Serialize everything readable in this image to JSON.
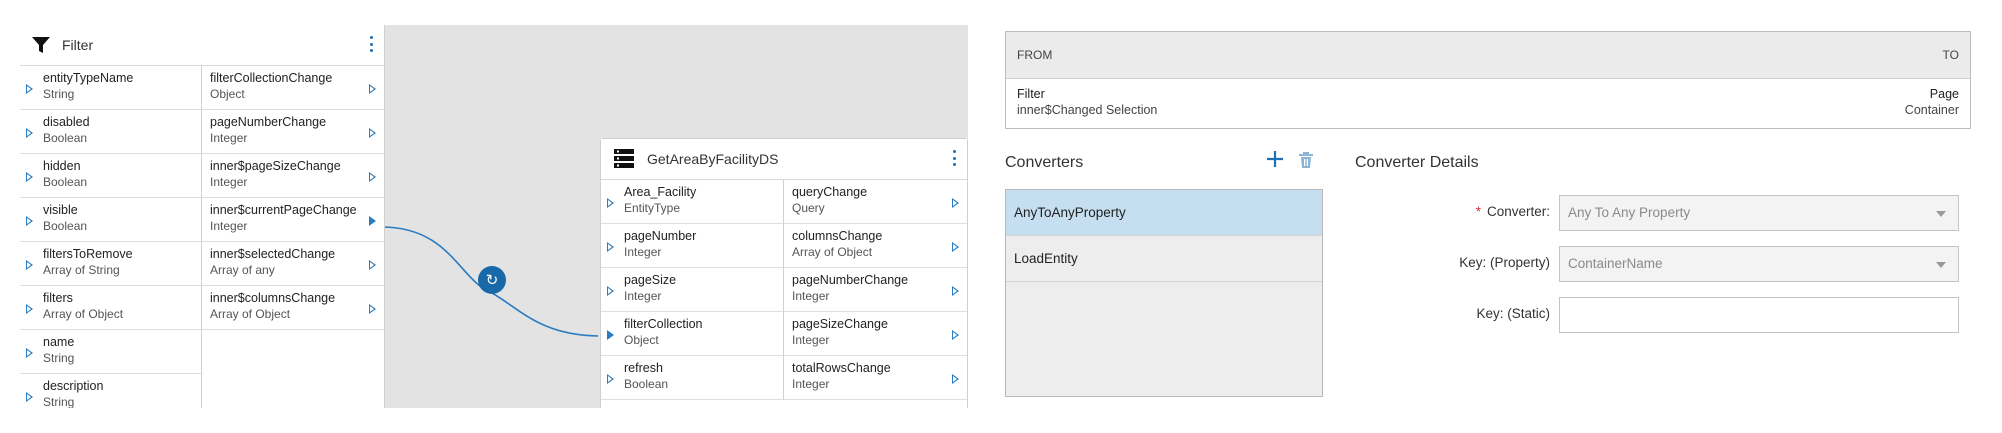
{
  "filter_node": {
    "title": "Filter",
    "inputs": [
      {
        "name": "entityTypeName",
        "type": "String"
      },
      {
        "name": "disabled",
        "type": "Boolean"
      },
      {
        "name": "hidden",
        "type": "Boolean"
      },
      {
        "name": "visible",
        "type": "Boolean"
      },
      {
        "name": "filtersToRemove",
        "type": "Array of String"
      },
      {
        "name": "filters",
        "type": "Array of Object"
      },
      {
        "name": "name",
        "type": "String"
      },
      {
        "name": "description",
        "type": "String"
      }
    ],
    "outputs": [
      {
        "name": "filterCollectionChange",
        "type": "Object"
      },
      {
        "name": "pageNumberChange",
        "type": "Integer"
      },
      {
        "name": "inner$pageSizeChange",
        "type": "Integer"
      },
      {
        "name": "inner$currentPageChange",
        "type": "Integer"
      },
      {
        "name": "inner$selectedChange",
        "type": "Array of any"
      },
      {
        "name": "inner$columnsChange",
        "type": "Array of Object"
      }
    ]
  },
  "ds_node": {
    "title": "GetAreaByFacilityDS",
    "inputs": [
      {
        "name": "Area_Facility",
        "type": "EntityType"
      },
      {
        "name": "pageNumber",
        "type": "Integer"
      },
      {
        "name": "pageSize",
        "type": "Integer"
      },
      {
        "name": "filterCollection",
        "type": "Object"
      },
      {
        "name": "refresh",
        "type": "Boolean"
      }
    ],
    "outputs": [
      {
        "name": "queryChange",
        "type": "Query"
      },
      {
        "name": "columnsChange",
        "type": "Array of Object"
      },
      {
        "name": "pageNumberChange",
        "type": "Integer"
      },
      {
        "name": "pageSizeChange",
        "type": "Integer"
      },
      {
        "name": "totalRowsChange",
        "type": "Integer"
      }
    ]
  },
  "mapping": {
    "from_label": "FROM",
    "to_label": "TO",
    "from_title": "Filter",
    "from_sub": "inner$Changed Selection",
    "to_title": "Page",
    "to_sub": "Container"
  },
  "converters": {
    "title": "Converters",
    "items": [
      "AnyToAnyProperty",
      "LoadEntity"
    ],
    "selected_index": 0
  },
  "details": {
    "title": "Converter Details",
    "converter_label": "Converter:",
    "converter_value": "Any To Any Property",
    "key_property_label": "Key: (Property)",
    "key_property_value": "ContainerName",
    "key_static_label": "Key: (Static)",
    "key_static_value": ""
  },
  "colors": {
    "accent": "#1f6fb3",
    "selected_row": "#c5dff0",
    "required": "#d32f2f"
  },
  "icons": [
    "filter-icon",
    "kebab-menu-icon",
    "datasource-icon",
    "sync-icon",
    "plus-icon",
    "trash-icon",
    "chevron-down-icon"
  ]
}
